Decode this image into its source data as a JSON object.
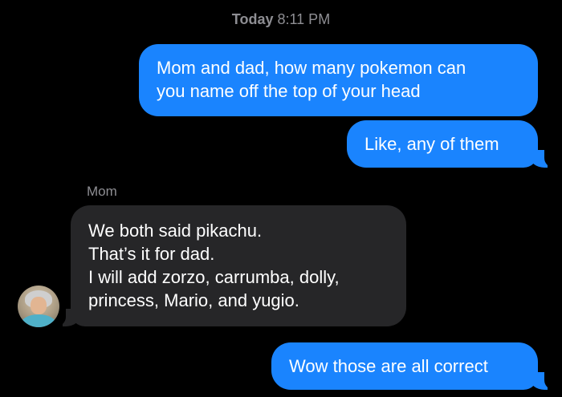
{
  "conversation": {
    "timestamp_day": "Today",
    "timestamp_time": "8:11 PM"
  },
  "messages": [
    {
      "direction": "outgoing",
      "lines": [
        "Mom and dad, how many pokemon can",
        "you name off the top of your head"
      ]
    },
    {
      "direction": "outgoing",
      "lines": [
        "Like, any of them"
      ]
    },
    {
      "direction": "incoming",
      "sender": "Mom",
      "lines": [
        "We both said pikachu.",
        "That’s it for dad.",
        "I will add zorzo, carrumba, dolly,",
        "princess, Mario, and yugio."
      ]
    },
    {
      "direction": "outgoing",
      "lines": [
        "Wow those are all correct"
      ]
    }
  ],
  "colors": {
    "outgoing_bubble": "#1a84fe",
    "incoming_bubble": "#262628",
    "background": "#000000",
    "meta_text": "#8e8e93"
  },
  "icons": {
    "contact_avatar": "avatar-photo"
  }
}
